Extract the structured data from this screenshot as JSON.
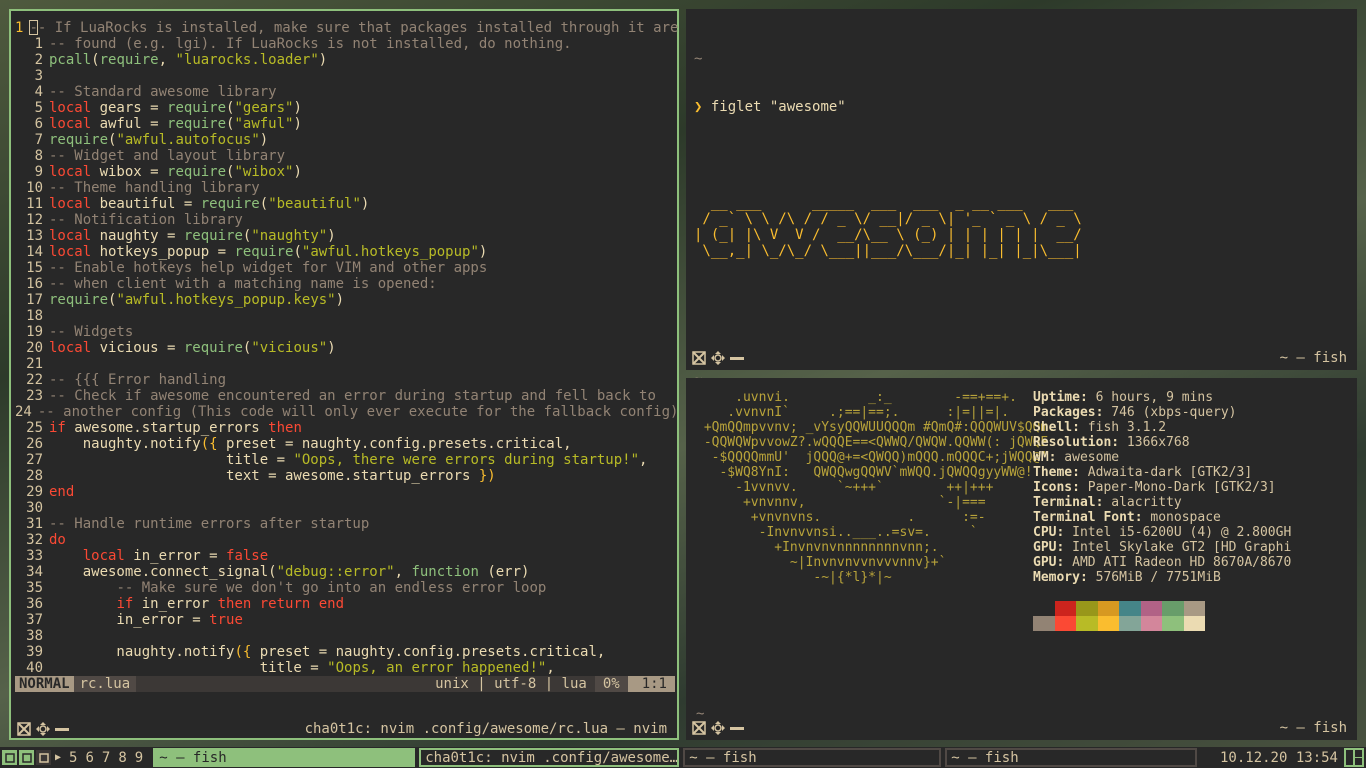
{
  "editor": {
    "lines": [
      {
        "num": "1",
        "cur": true,
        "segs": [
          [
            "cm",
            "-- If LuaRocks is installed, make sure that packages installed through it are"
          ]
        ]
      },
      {
        "num": "1",
        "segs": [
          [
            "cm",
            "-- found (e.g. lgi). If LuaRocks is not installed, do nothing."
          ]
        ]
      },
      {
        "num": "2",
        "segs": [
          [
            "fn",
            "pcall"
          ],
          [
            "tx",
            "("
          ],
          [
            "fn",
            "require"
          ],
          [
            "tx",
            ", "
          ],
          [
            "st",
            "\"luarocks.loader\""
          ],
          [
            "tx",
            ")"
          ]
        ]
      },
      {
        "num": "3",
        "segs": []
      },
      {
        "num": "4",
        "segs": [
          [
            "cm",
            "-- Standard awesome library"
          ]
        ]
      },
      {
        "num": "5",
        "segs": [
          [
            "kw",
            "local "
          ],
          [
            "tx",
            "gears = "
          ],
          [
            "fn",
            "require"
          ],
          [
            "tx",
            "("
          ],
          [
            "st",
            "\"gears\""
          ],
          [
            "tx",
            ")"
          ]
        ]
      },
      {
        "num": "6",
        "segs": [
          [
            "kw",
            "local "
          ],
          [
            "tx",
            "awful = "
          ],
          [
            "fn",
            "require"
          ],
          [
            "tx",
            "("
          ],
          [
            "st",
            "\"awful\""
          ],
          [
            "tx",
            ")"
          ]
        ]
      },
      {
        "num": "7",
        "segs": [
          [
            "fn",
            "require"
          ],
          [
            "tx",
            "("
          ],
          [
            "st",
            "\"awful.autofocus\""
          ],
          [
            "tx",
            ")"
          ]
        ]
      },
      {
        "num": "8",
        "segs": [
          [
            "cm",
            "-- Widget and layout library"
          ]
        ]
      },
      {
        "num": "9",
        "segs": [
          [
            "kw",
            "local "
          ],
          [
            "tx",
            "wibox = "
          ],
          [
            "fn",
            "require"
          ],
          [
            "tx",
            "("
          ],
          [
            "st",
            "\"wibox\""
          ],
          [
            "tx",
            ")"
          ]
        ]
      },
      {
        "num": "10",
        "segs": [
          [
            "cm",
            "-- Theme handling library"
          ]
        ]
      },
      {
        "num": "11",
        "segs": [
          [
            "kw",
            "local "
          ],
          [
            "tx",
            "beautiful = "
          ],
          [
            "fn",
            "require"
          ],
          [
            "tx",
            "("
          ],
          [
            "st",
            "\"beautiful\""
          ],
          [
            "tx",
            ")"
          ]
        ]
      },
      {
        "num": "12",
        "segs": [
          [
            "cm",
            "-- Notification library"
          ]
        ]
      },
      {
        "num": "13",
        "segs": [
          [
            "kw",
            "local "
          ],
          [
            "tx",
            "naughty = "
          ],
          [
            "fn",
            "require"
          ],
          [
            "tx",
            "("
          ],
          [
            "st",
            "\"naughty\""
          ],
          [
            "tx",
            ")"
          ]
        ]
      },
      {
        "num": "14",
        "segs": [
          [
            "kw",
            "local "
          ],
          [
            "tx",
            "hotkeys_popup = "
          ],
          [
            "fn",
            "require"
          ],
          [
            "tx",
            "("
          ],
          [
            "st",
            "\"awful.hotkeys_popup\""
          ],
          [
            "tx",
            ")"
          ]
        ]
      },
      {
        "num": "15",
        "segs": [
          [
            "cm",
            "-- Enable hotkeys help widget for VIM and other apps"
          ]
        ]
      },
      {
        "num": "16",
        "segs": [
          [
            "cm",
            "-- when client with a matching name is opened:"
          ]
        ]
      },
      {
        "num": "17",
        "segs": [
          [
            "fn",
            "require"
          ],
          [
            "tx",
            "("
          ],
          [
            "st",
            "\"awful.hotkeys_popup.keys\""
          ],
          [
            "tx",
            ")"
          ]
        ]
      },
      {
        "num": "18",
        "segs": []
      },
      {
        "num": "19",
        "segs": [
          [
            "cm",
            "-- Widgets"
          ]
        ]
      },
      {
        "num": "20",
        "segs": [
          [
            "kw",
            "local "
          ],
          [
            "tx",
            "vicious = "
          ],
          [
            "fn",
            "require"
          ],
          [
            "tx",
            "("
          ],
          [
            "st",
            "\"vicious\""
          ],
          [
            "tx",
            ")"
          ]
        ]
      },
      {
        "num": "21",
        "segs": []
      },
      {
        "num": "22",
        "segs": [
          [
            "cm",
            "-- {{{ Error handling"
          ]
        ]
      },
      {
        "num": "23",
        "segs": [
          [
            "cm",
            "-- Check if awesome encountered an error during startup and fell back to"
          ]
        ]
      },
      {
        "num": "24",
        "segs": [
          [
            "cm",
            "-- another config (This code will only ever execute for the fallback config)"
          ]
        ]
      },
      {
        "num": "25",
        "segs": [
          [
            "kw",
            "if "
          ],
          [
            "tx",
            "awesome.startup_errors "
          ],
          [
            "kw",
            "then"
          ]
        ]
      },
      {
        "num": "26",
        "segs": [
          [
            "tx",
            "    naughty.notify"
          ],
          [
            "br",
            "({ "
          ],
          [
            "tx",
            "preset = naughty.config.presets.critical,"
          ]
        ]
      },
      {
        "num": "27",
        "segs": [
          [
            "tx",
            "                     title = "
          ],
          [
            "st",
            "\"Oops, there were errors during startup!\""
          ],
          [
            "tx",
            ","
          ]
        ]
      },
      {
        "num": "28",
        "segs": [
          [
            "tx",
            "                     text = awesome.startup_errors "
          ],
          [
            "br",
            "})"
          ]
        ]
      },
      {
        "num": "29",
        "segs": [
          [
            "kw",
            "end"
          ]
        ]
      },
      {
        "num": "30",
        "segs": []
      },
      {
        "num": "31",
        "segs": [
          [
            "cm",
            "-- Handle runtime errors after startup"
          ]
        ]
      },
      {
        "num": "32",
        "segs": [
          [
            "kw",
            "do"
          ]
        ]
      },
      {
        "num": "33",
        "segs": [
          [
            "tx",
            "    "
          ],
          [
            "kw",
            "local "
          ],
          [
            "tx",
            "in_error = "
          ],
          [
            "kw",
            "false"
          ]
        ]
      },
      {
        "num": "34",
        "segs": [
          [
            "tx",
            "    awesome.connect_signal("
          ],
          [
            "st",
            "\"debug::error\""
          ],
          [
            "tx",
            ", "
          ],
          [
            "fn",
            "function "
          ],
          [
            "tx",
            "(err)"
          ]
        ]
      },
      {
        "num": "35",
        "segs": [
          [
            "tx",
            "        "
          ],
          [
            "cm",
            "-- Make sure we don't go into an endless error loop"
          ]
        ]
      },
      {
        "num": "36",
        "segs": [
          [
            "tx",
            "        "
          ],
          [
            "kw",
            "if "
          ],
          [
            "tx",
            "in_error "
          ],
          [
            "kw",
            "then return end"
          ]
        ]
      },
      {
        "num": "37",
        "segs": [
          [
            "tx",
            "        in_error = "
          ],
          [
            "kw",
            "true"
          ]
        ]
      },
      {
        "num": "38",
        "segs": []
      },
      {
        "num": "39",
        "segs": [
          [
            "tx",
            "        naughty.notify"
          ],
          [
            "br",
            "({ "
          ],
          [
            "tx",
            "preset = naughty.config.presets.critical,"
          ]
        ]
      },
      {
        "num": "40",
        "segs": [
          [
            "tx",
            "                         title = "
          ],
          [
            "st",
            "\"Oops, an error happened!\""
          ],
          [
            "tx",
            ","
          ]
        ]
      }
    ],
    "status": {
      "mode": "NORMAL",
      "file": "rc.lua",
      "enc": "unix | utf-8 | lua",
      "pct": "0%",
      "pos": "1:1"
    },
    "title": "cha0t1c: nvim .config/awesome/rc.lua — nvim"
  },
  "term1": {
    "tilde1": "~",
    "arrow": "❯",
    "command": " figlet \"awesome\"",
    "figlet": "  __ ___      _____  ___  ___  _ __ ___   ___ \n / _` \\ \\ /\\ / / _ \\/ __|/ _ \\| '_ ` _ \\ / _ \\\n| (_| |\\ V  V /  __/\\__ \\ (_) | | | | | |  __/\n \\__,_| \\_/\\_/ \\___||___/\\___/|_| |_| |_|\\___|",
    "tilde2": "~",
    "title": "~ — fish"
  },
  "term2": {
    "ascii": "     .uvnvi.          _:_        -==+==+.\n    .vvnvnI`     .;==|==;.      :|=||=|.\n +QmQQmpvvnv; _vYsyQQWUUQQQm #QmQ#:QQQWUV$QQm.\n -QQWQWpvvowZ?.wQQQE==<QWWQ/QWQW.QQWW(: jQWQE\n  -$QQQQmmU'  jQQQ@+=<QWQQ)mQQQ.mQQQC+;jWQQ@'\n   -$WQ8YnI:   QWQQwgQQWV`mWQQ.jQWQQgyyWW@!\n     -1vvnvv.     `~+++`        ++|+++\n      +vnvnnv,                 `-|===\n       +vnvnvns.           .      :=-\n        -Invnvvnsi..___..=sv=.     `\n          +Invnvnvnnnnnnnnvnn;.\n            ~|Invnvnvvnvvvnnv}+`\n               -~|{*l}*|~",
    "info": [
      [
        "Uptime:",
        " 6 hours, 9 mins"
      ],
      [
        "Packages:",
        " 746 (xbps-query)"
      ],
      [
        "Shell:",
        " fish 3.1.2"
      ],
      [
        "Resolution:",
        " 1366x768"
      ],
      [
        "WM:",
        " awesome"
      ],
      [
        "Theme:",
        " Adwaita-dark [GTK2/3]"
      ],
      [
        "Icons:",
        " Paper-Mono-Dark [GTK2/3]"
      ],
      [
        "Terminal:",
        " alacritty"
      ],
      [
        "Terminal Font:",
        " monospace"
      ],
      [
        "CPU:",
        " Intel i5-6200U (4) @ 2.800GH"
      ],
      [
        "GPU:",
        " Intel Skylake GT2 [HD Graphi"
      ],
      [
        "GPU:",
        " AMD ATI Radeon HD 8670A/8670"
      ],
      [
        "Memory:",
        " 576MiB / 7751MiB"
      ]
    ],
    "swatches_top": [
      "#282828",
      "#cc241d",
      "#98971a",
      "#d79921",
      "#458588",
      "#b16286",
      "#689d6a",
      "#a89984"
    ],
    "swatches_bottom": [
      "#928374",
      "#fb4934",
      "#b8bb26",
      "#fabd2f",
      "#83a598",
      "#d3869b",
      "#8ec07c",
      "#ebdbb2"
    ],
    "tilde": "~",
    "arrow": "❯",
    "title": "~ — fish"
  },
  "taskbar": {
    "tags": [
      "5",
      "6",
      "7",
      "8",
      "9"
    ],
    "tasks": [
      {
        "label": "~ — fish",
        "state": "active"
      },
      {
        "label": "cha0t1c: nvim .config/awesome…",
        "state": "focus"
      },
      {
        "label": "~ — fish",
        "state": "normal"
      },
      {
        "label": "~ — fish",
        "state": "normal"
      }
    ],
    "clock": "10.12.20 13:54"
  },
  "colors": {
    "accent": "#8ec07c",
    "bg": "#282828",
    "fg": "#d5c4a1",
    "yellow": "#fabd2f",
    "red": "#fb4934",
    "green": "#b8bb26"
  }
}
